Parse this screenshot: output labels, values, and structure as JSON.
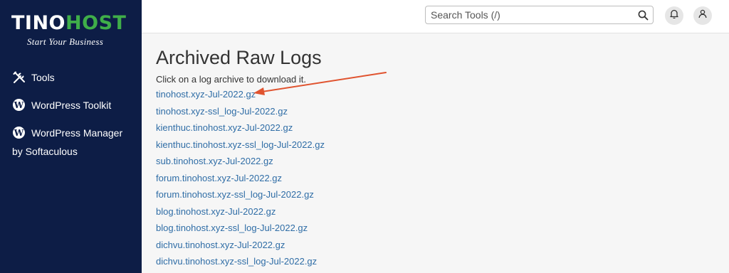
{
  "sidebar": {
    "logo": {
      "word_a": "TINO",
      "word_b": "HOST",
      "slogan": "Start Your Business"
    },
    "items": [
      {
        "label": "Tools",
        "icon": "tools-icon"
      },
      {
        "label": "WordPress Toolkit",
        "icon": "wordpress-icon"
      },
      {
        "label": "WordPress Manager",
        "icon": "wordpress-icon"
      }
    ],
    "item_sub": "by Softaculous"
  },
  "topbar": {
    "search_placeholder": "Search Tools (/)",
    "icons": [
      "search-icon",
      "bell-icon",
      "user-icon"
    ]
  },
  "main": {
    "title": "Archived Raw Logs",
    "description": "Click on a log archive to download it.",
    "logs": [
      "tinohost.xyz-Jul-2022.gz",
      "tinohost.xyz-ssl_log-Jul-2022.gz",
      "kienthuc.tinohost.xyz-Jul-2022.gz",
      "kienthuc.tinohost.xyz-ssl_log-Jul-2022.gz",
      "sub.tinohost.xyz-Jul-2022.gz",
      "forum.tinohost.xyz-Jul-2022.gz",
      "forum.tinohost.xyz-ssl_log-Jul-2022.gz",
      "blog.tinohost.xyz-Jul-2022.gz",
      "blog.tinohost.xyz-ssl_log-Jul-2022.gz",
      "dichvu.tinohost.xyz-Jul-2022.gz",
      "dichvu.tinohost.xyz-ssl_log-Jul-2022.gz"
    ]
  },
  "colors": {
    "sidebar_bg": "#0d1d46",
    "link": "#2f6da6",
    "brand_green": "#3fae49",
    "annotation_arrow": "#e0532f"
  }
}
